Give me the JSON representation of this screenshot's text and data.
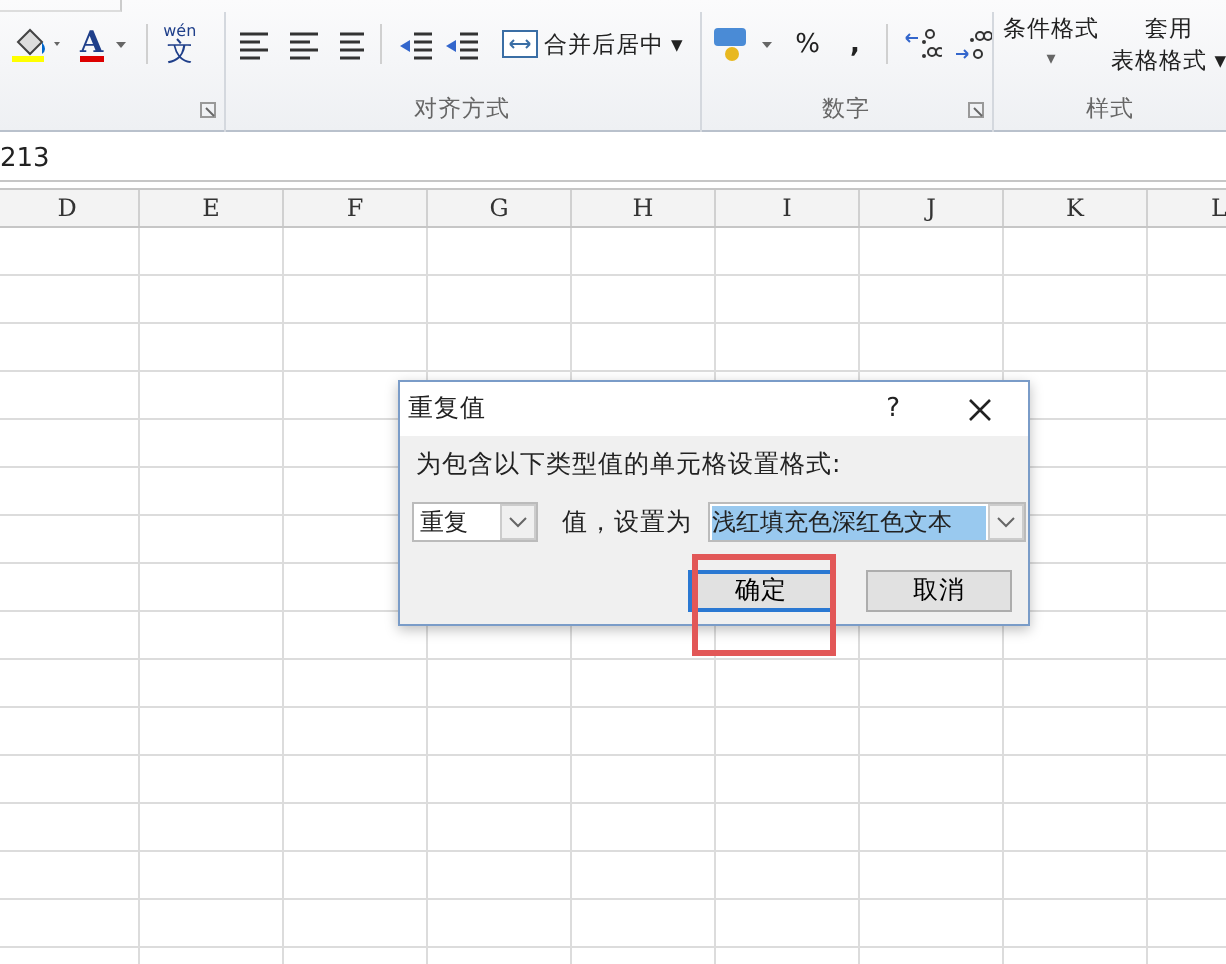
{
  "ribbon": {
    "font_color_glyph": "A",
    "phonetic": {
      "top": "wén",
      "glyph": "文"
    },
    "merge_button": "合并后居中 ▾",
    "percent_button": "%",
    "comma_button": ",",
    "conditional_format": {
      "label": "条件格式",
      "caret": "▾"
    },
    "format_table": {
      "line1": "套用",
      "line2": "表格格式 ▾"
    },
    "group_labels": [
      "对齐方式",
      "数字",
      "样式"
    ]
  },
  "formula_bar": {
    "value": "213"
  },
  "columns": [
    "D",
    "E",
    "F",
    "G",
    "H",
    "I",
    "J",
    "K",
    "L"
  ],
  "dialog": {
    "title": "重复值",
    "help": "?",
    "prompt": "为包含以下类型值的单元格设置格式:",
    "rule_select": {
      "value": "重复"
    },
    "middle_label": "值，设置为",
    "format_select": {
      "value": "浅红填充色深红色文本"
    },
    "buttons": [
      {
        "label": "确定",
        "focused": true
      },
      {
        "label": "取消",
        "focused": false
      }
    ]
  }
}
